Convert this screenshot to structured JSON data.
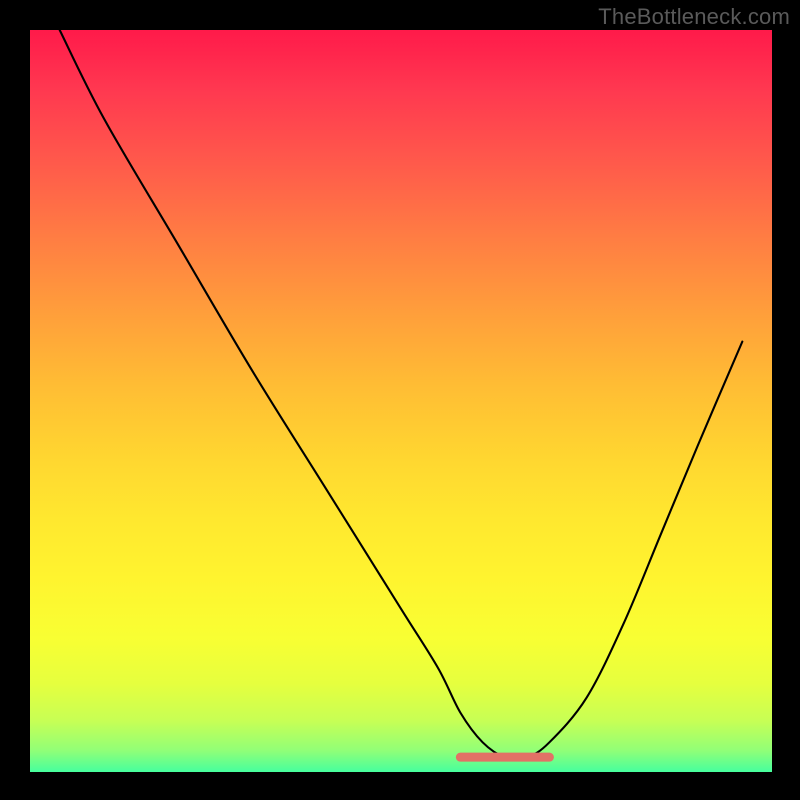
{
  "attribution": "TheBottleneck.com",
  "colors": {
    "background": "#000000",
    "gradient_top": "#ff1a4a",
    "gradient_bottom": "#46ff9e",
    "curve": "#000000",
    "highlight": "#e27166"
  },
  "chart_data": {
    "type": "line",
    "title": "",
    "xlabel": "",
    "ylabel": "",
    "xlim": [
      0,
      100
    ],
    "ylim": [
      0,
      100
    ],
    "series": [
      {
        "name": "bottleneck-curve",
        "x": [
          4,
          10,
          20,
          30,
          40,
          50,
          55,
          58,
          61,
          64,
          67,
          70,
          75,
          80,
          85,
          90,
          96
        ],
        "values": [
          100,
          88,
          71,
          54,
          38,
          22,
          14,
          8,
          4,
          2,
          2,
          4,
          10,
          20,
          32,
          44,
          58
        ]
      }
    ],
    "annotations": [
      {
        "name": "highlight-band",
        "type": "segment",
        "x_start": 58,
        "x_end": 70,
        "y": 2,
        "color": "#e27166"
      }
    ]
  }
}
